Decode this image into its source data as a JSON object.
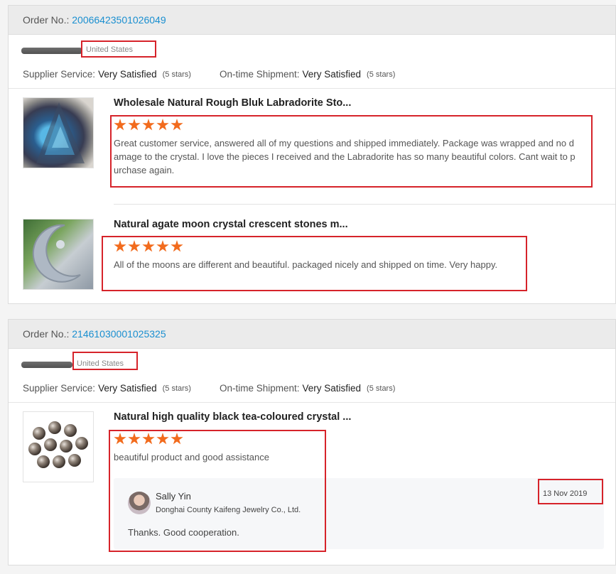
{
  "orders": [
    {
      "order_label": "Order No.:",
      "order_no": "20066423501026049",
      "country": "United States",
      "supplier_label": "Supplier Service:",
      "supplier_value": "Very Satisfied",
      "supplier_stars": "(5 stars)",
      "shipment_label": "On-time Shipment:",
      "shipment_value": "Very Satisfied",
      "shipment_stars": "(5 stars)",
      "items": [
        {
          "title": "Wholesale Natural Rough Bluk Labradorite Sto...",
          "rating": 5,
          "review": "Great customer service, answered all of my questions and shipped immediately. Package was wrapped and no damage to the crystal. I love the pieces I received and the Labradorite has so many beautiful colors. Cant wait to purchase again."
        },
        {
          "title": "Natural agate moon crystal crescent stones m...",
          "rating": 5,
          "review": "All of the moons are different and beautiful. packaged nicely and shipped on time. Very happy."
        }
      ]
    },
    {
      "order_label": "Order No.:",
      "order_no": "21461030001025325",
      "country": "United States",
      "supplier_label": "Supplier Service:",
      "supplier_value": "Very Satisfied",
      "supplier_stars": "(5 stars)",
      "shipment_label": "On-time Shipment:",
      "shipment_value": "Very Satisfied",
      "shipment_stars": "(5 stars)",
      "items": [
        {
          "title": "Natural high quality black tea-coloured crystal ...",
          "rating": 5,
          "review": "beautiful product and good assistance",
          "reply": {
            "name": "Sally Yin",
            "shop": "Donghai County Kaifeng Jewelry Co., Ltd.",
            "text": "Thanks. Good cooperation.",
            "date": "13 Nov 2019"
          }
        }
      ]
    }
  ],
  "colors": {
    "accent_star": "#f26b1d",
    "link": "#1a8fd0",
    "annotation_red": "#d6232a"
  }
}
